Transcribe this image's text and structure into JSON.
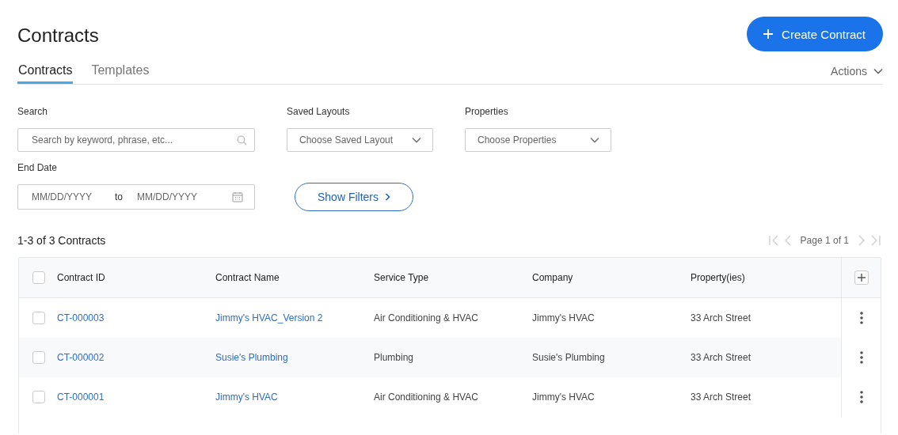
{
  "page": {
    "title": "Contracts"
  },
  "create_button": {
    "label": "Create Contract"
  },
  "tabs": [
    {
      "label": "Contracts",
      "selected": true
    },
    {
      "label": "Templates",
      "selected": false
    }
  ],
  "actions_menu": {
    "label": "Actions"
  },
  "filters": [
    {
      "kind": "search",
      "label": "Search",
      "placeholder": "Search by keyword, phrase, etc..."
    },
    {
      "kind": "select",
      "label": "Saved Layouts",
      "placeholder": "Choose Saved Layout"
    },
    {
      "kind": "select",
      "label": "Properties",
      "placeholder": "Choose Properties"
    },
    {
      "kind": "daterange",
      "label": "End Date",
      "from_placeholder": "MM/DD/YYYY",
      "separator": "to",
      "to_placeholder": "MM/DD/YYYY"
    }
  ],
  "show_filters_button": {
    "label": "Show Filters"
  },
  "results": {
    "count": "1-3 of 3 Contracts"
  },
  "pagination": {
    "label": "Page 1 of 1",
    "disabled": true
  },
  "table": {
    "header_checked": false,
    "columns": [
      {
        "label": "Contract ID",
        "kind": "link"
      },
      {
        "label": "Contract Name",
        "kind": "link"
      },
      {
        "label": "Service Type",
        "kind": "text"
      },
      {
        "label": "Company",
        "kind": "text"
      },
      {
        "label": "Property(ies)",
        "kind": "text"
      }
    ],
    "rows": [
      {
        "checked": false,
        "cells": [
          "CT-000003",
          "Jimmy's HVAC_Version 2",
          "Air Conditioning & HVAC",
          "Jimmy's HVAC",
          "33 Arch Street"
        ]
      },
      {
        "checked": false,
        "cells": [
          "CT-000002",
          "Susie's Plumbing",
          "Plumbing",
          "Susie's Plumbing",
          "33 Arch Street"
        ]
      },
      {
        "checked": false,
        "cells": [
          "CT-000001",
          "Jimmy's HVAC",
          "Air Conditioning & HVAC",
          "Jimmy's HVAC",
          "33 Arch Street"
        ]
      }
    ]
  }
}
